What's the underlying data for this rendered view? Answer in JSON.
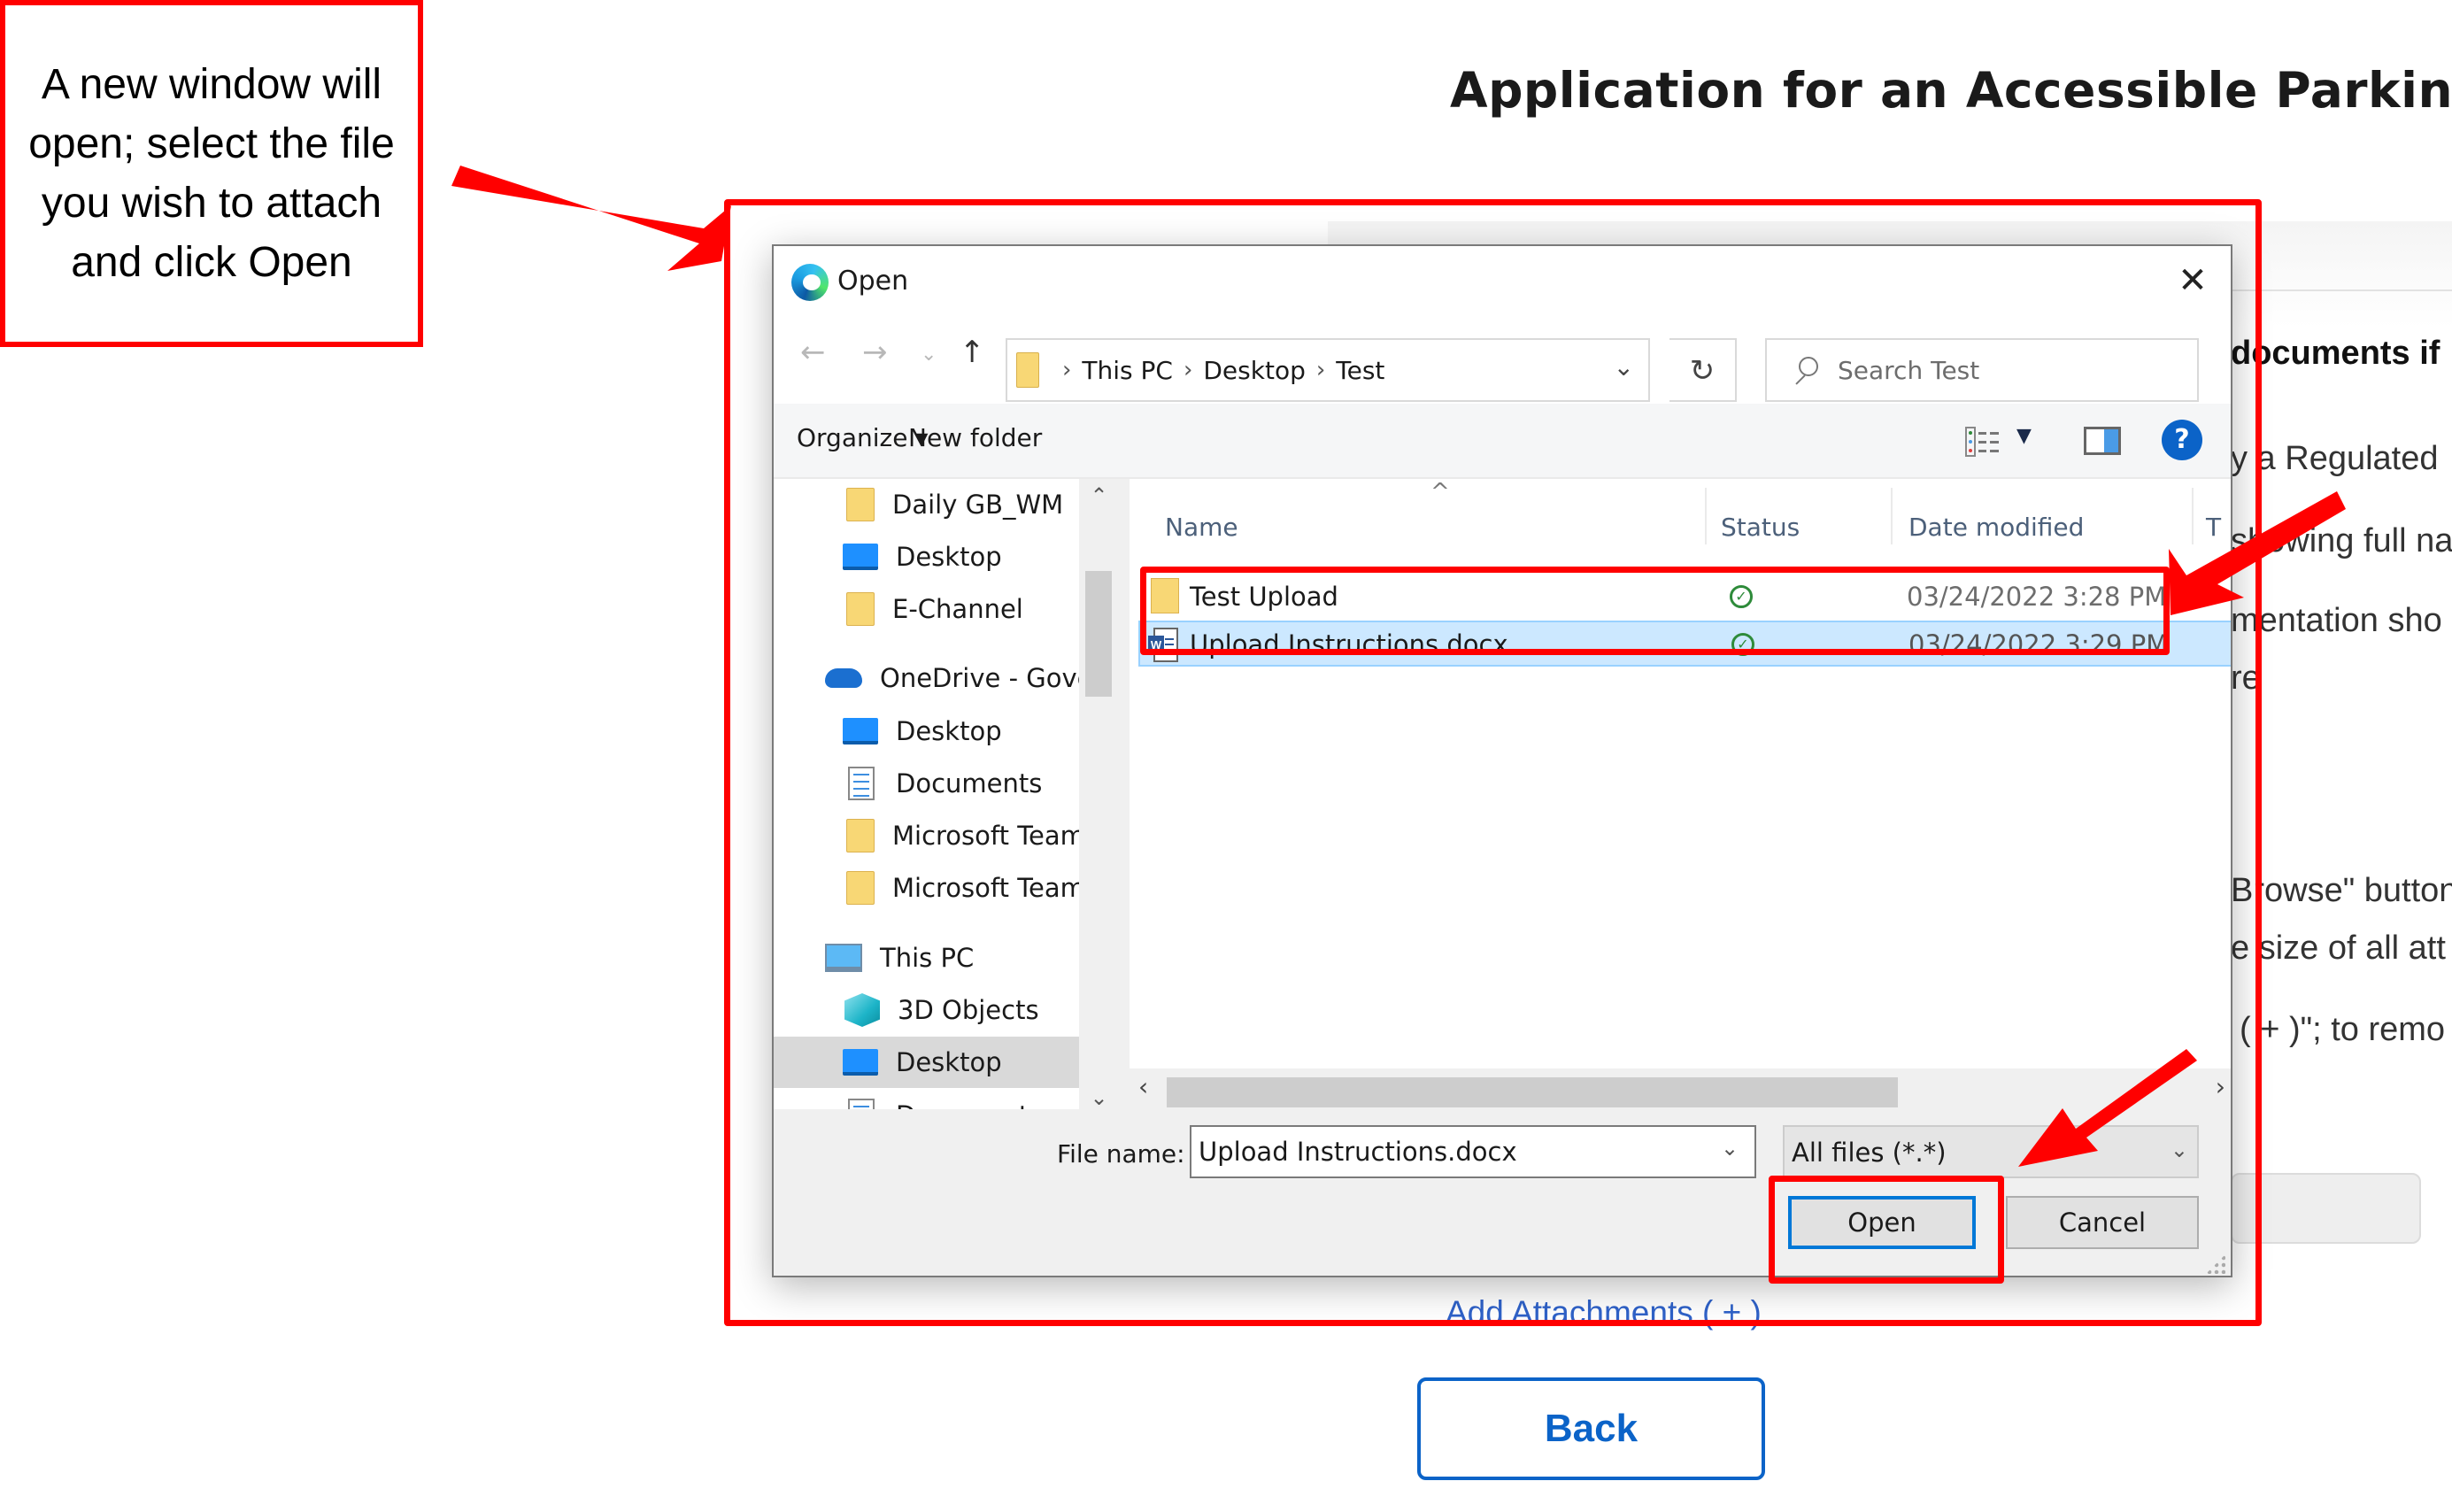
{
  "page": {
    "title": "Application for an Accessible Parking P",
    "background_lines": [
      {
        "text": "documents if",
        "bold": true
      },
      {
        "text": "y a Regulated",
        "bold": false
      },
      {
        "text": "showing full na",
        "bold": false
      },
      {
        "text": "mentation sho",
        "bold": false
      },
      {
        "text": "re",
        "bold": false
      },
      {
        "text": "Browse\" button",
        "bold": false
      },
      {
        "text": "e size of all att",
        "bold": false
      },
      {
        "text": "( + )\"; to remo",
        "bold": false
      }
    ],
    "add_attachments_link": "Add Attachments ( + )",
    "back_button": "Back"
  },
  "callout": {
    "text": "A new window will open; select the file you wish to attach and click Open"
  },
  "annotation_color": "#ff0000",
  "dialog": {
    "title": "Open",
    "close_icon": "close-icon",
    "nav": {
      "back_icon": "←",
      "forward_icon": "→",
      "recent_icon": "⌄",
      "up_icon": "↑",
      "breadcrumb": [
        "This PC",
        "Desktop",
        "Test"
      ],
      "refresh_icon": "↻",
      "search_placeholder": "Search Test"
    },
    "toolbar": {
      "organize": "Organize ▾",
      "new_folder": "New folder",
      "help": "?"
    },
    "sidebar": {
      "items": [
        {
          "label": "Daily GB_WM",
          "icon": "folder",
          "indent": 1
        },
        {
          "label": "Desktop",
          "icon": "desktop",
          "indent": 1
        },
        {
          "label": "E-Channel",
          "icon": "folder",
          "indent": 1
        },
        {
          "label": "OneDrive - Govern",
          "icon": "cloud",
          "indent": 0
        },
        {
          "label": "Desktop",
          "icon": "desktop",
          "indent": 1
        },
        {
          "label": "Documents",
          "icon": "doc",
          "indent": 1
        },
        {
          "label": "Microsoft Teams",
          "icon": "folder",
          "indent": 1
        },
        {
          "label": "Microsoft Teams",
          "icon": "folder",
          "indent": 1
        },
        {
          "label": "This PC",
          "icon": "pc",
          "indent": 0
        },
        {
          "label": "3D Objects",
          "icon": "3d",
          "indent": 1
        },
        {
          "label": "Desktop",
          "icon": "desktop",
          "indent": 1,
          "selected": true
        },
        {
          "label": "Documents",
          "icon": "doc",
          "indent": 1
        }
      ]
    },
    "columns": [
      "Name",
      "Status",
      "Date modified",
      "T"
    ],
    "files": [
      {
        "name": "Test Upload",
        "type": "folder",
        "status": "synced",
        "date": "03/24/2022 3:28 PM",
        "selected": false
      },
      {
        "name": "Upload Instructions.docx",
        "type": "docx",
        "status": "synced",
        "date": "03/24/2022 3:29 PM",
        "selected": true
      }
    ],
    "file_name_label": "File name:",
    "file_name_value": "Upload Instructions.docx",
    "file_type_filter": "All files (*.*)",
    "open_button": "Open",
    "cancel_button": "Cancel"
  }
}
